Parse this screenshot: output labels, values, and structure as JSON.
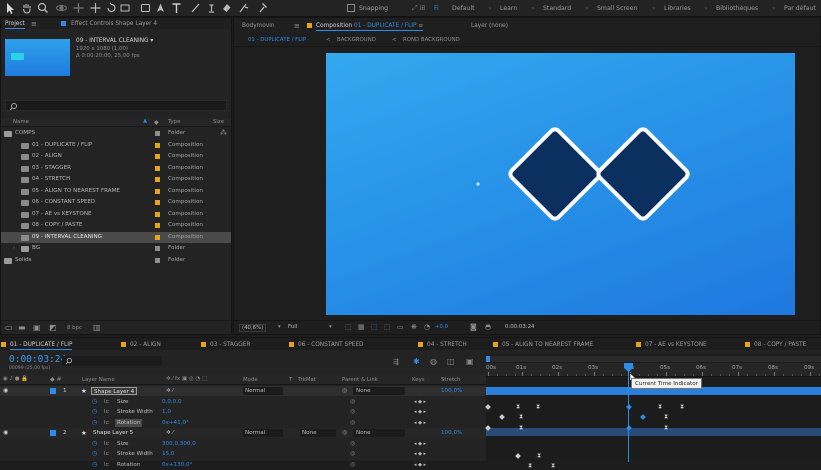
{
  "toolbar": {
    "snapping_label": "Snapping",
    "workspaces": [
      "Default",
      "Learn",
      "Standard",
      "Small Screen",
      "Libraries",
      "Bibliothèques",
      "Par défaut"
    ]
  },
  "project_panel": {
    "tab_label": "Project",
    "effect_controls_label": "Effect Controls Shape Layer 4",
    "selected_item_name": "09 - INTERVAL CLEANING ▾",
    "selected_item_info1": "1920 x 1080 (1,00)",
    "selected_item_info2": "Δ 0:00:20:00, 25,00 fps",
    "search_placeholder": "",
    "columns": {
      "name": "Name",
      "type": "Type",
      "size": "Size"
    },
    "items": [
      {
        "name": "COMPS",
        "type": "Folder",
        "kind": "folder",
        "indent": 0
      },
      {
        "name": "01 - DUPLICATE / FLIP",
        "type": "Composition",
        "kind": "comp",
        "indent": 1
      },
      {
        "name": "02 - ALIGN",
        "type": "Composition",
        "kind": "comp",
        "indent": 1
      },
      {
        "name": "03 - STAGGER",
        "type": "Composition",
        "kind": "comp",
        "indent": 1
      },
      {
        "name": "04 - STRETCH",
        "type": "Composition",
        "kind": "comp",
        "indent": 1
      },
      {
        "name": "05 - ALIGN TO NEAREST FRAME",
        "type": "Composition",
        "kind": "comp",
        "indent": 1
      },
      {
        "name": "06 - CONSTANT SPEED",
        "type": "Composition",
        "kind": "comp",
        "indent": 1
      },
      {
        "name": "07 - AE vs KEYSTONE",
        "type": "Composition",
        "kind": "comp",
        "indent": 1
      },
      {
        "name": "08 - COPY / PASTE",
        "type": "Composition",
        "kind": "comp",
        "indent": 1
      },
      {
        "name": "09 - INTERVAL CLEANING",
        "type": "Composition",
        "kind": "comp",
        "indent": 1,
        "selected": true
      },
      {
        "name": "BG",
        "type": "Folder",
        "kind": "folder",
        "indent": 1
      },
      {
        "name": "Solids",
        "type": "Folder",
        "kind": "folder",
        "indent": 0
      }
    ],
    "bpc": "8 bpc"
  },
  "viewer": {
    "tabs": [
      {
        "label": "Bodymovin"
      },
      {
        "label": "Composition",
        "sub": " 01 - DUPLICATE / FLIP"
      },
      {
        "label": "Layer (none)"
      }
    ],
    "breadcrumbs": [
      "01 - DUPLICATE / FLIP",
      "BACKGROUND",
      "ROND BACKGROUND"
    ],
    "zoom": "(40,6%)",
    "resolution": "Full",
    "exposure": "+0,0",
    "timecode": "0:00:03:24"
  },
  "timeline": {
    "tabs": [
      "01 - DUPLICATE / FLIP",
      "02 - ALIGN",
      "03 - STAGGER",
      "06 - CONSTANT SPEED",
      "04 - STRETCH",
      "05 - ALIGN TO NEAREST FRAME",
      "07 - AE vs KEYSTONE",
      "08 - COPY / PASTE"
    ],
    "current_time": "0:00:03:24",
    "current_time_sub": "00099 (25,00 fps)",
    "headers": {
      "layer_name": "Layer Name",
      "mode": "Mode",
      "t": "T",
      "trkmat": "TrkMat",
      "parent": "Parent & Link",
      "keys": "Keys",
      "stretch": "Stretch"
    },
    "ruler": [
      "00s",
      "01s",
      "02s",
      "03s",
      "04s",
      "05s",
      "06s",
      "07s",
      "08s",
      "09s"
    ],
    "tooltip": "Current Time Indicator",
    "rows": [
      {
        "num": "1",
        "name": "Shape Layer 4",
        "kind": "layer",
        "mode": "Normal",
        "trkmat": "",
        "parent": "None",
        "stretch": "100,0%"
      },
      {
        "name": "Size",
        "kind": "prop",
        "value": "0,0,0,0"
      },
      {
        "name": "Stroke Width",
        "kind": "prop",
        "value": "1,0"
      },
      {
        "name": "Rotation",
        "kind": "prop",
        "value": "0x+41,0°"
      },
      {
        "num": "2",
        "name": "Shape Layer 5",
        "kind": "layer",
        "mode": "Normal",
        "trkmat": "None",
        "parent": "None",
        "stretch": "100,0%"
      },
      {
        "name": "Size",
        "kind": "prop",
        "value": "300,0,300,0"
      },
      {
        "name": "Stroke Width",
        "kind": "prop",
        "value": "15,0"
      },
      {
        "name": "Rotation",
        "kind": "prop",
        "value": "0x+130,0°"
      }
    ]
  },
  "colors": {
    "accent": "#2d8ceb",
    "comp_label": "#e6a31e",
    "canvas_top": "#2fa3ea",
    "canvas_bottom": "#1e79e0",
    "diamond": "#0b2f5e"
  }
}
